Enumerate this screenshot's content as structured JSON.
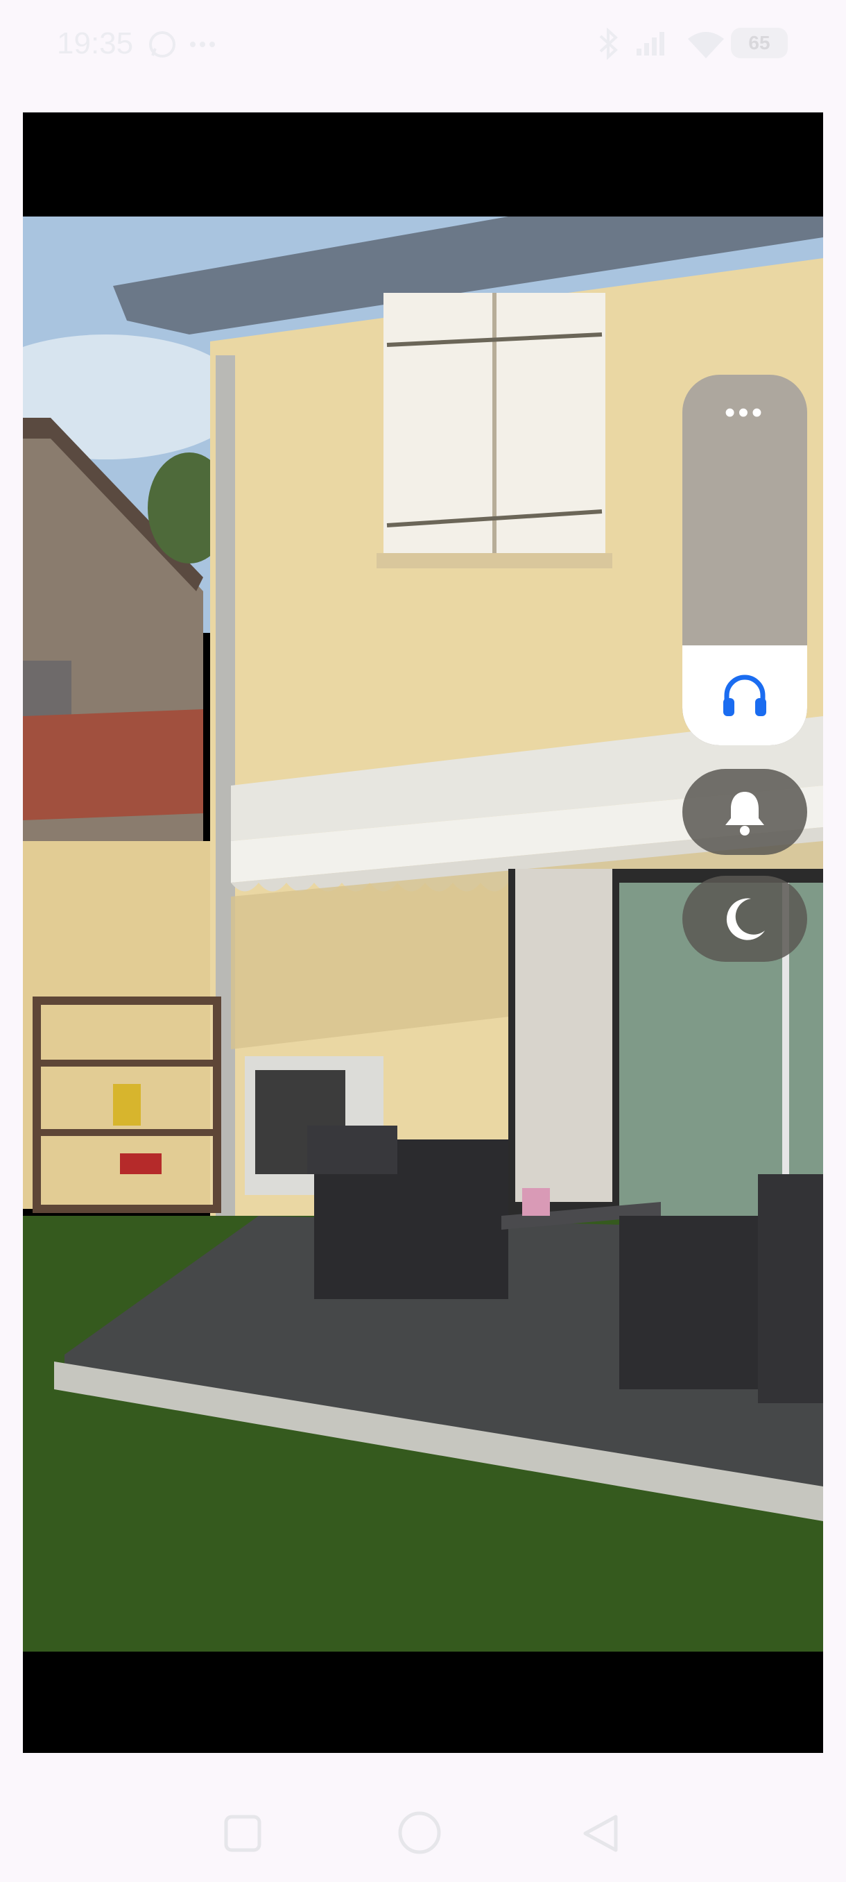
{
  "status_bar": {
    "time": "19:35",
    "battery": "65",
    "icons": [
      "whatsapp-icon",
      "more-notifications-icon",
      "bluetooth-icon",
      "signal-icon",
      "wifi-icon",
      "battery-icon"
    ]
  },
  "viewer": {
    "image_description_icon": "photo-house-garden"
  },
  "volume_panel": {
    "more_label": "•••",
    "level_fraction": 0.27,
    "active_stream_icon": "headphones-icon",
    "buttons": [
      "bell-icon",
      "moon-icon"
    ],
    "accent_color": "#1a6cf0"
  },
  "nav_bar": {
    "buttons": [
      "recents-square-icon",
      "home-circle-icon",
      "back-triangle-icon"
    ]
  }
}
